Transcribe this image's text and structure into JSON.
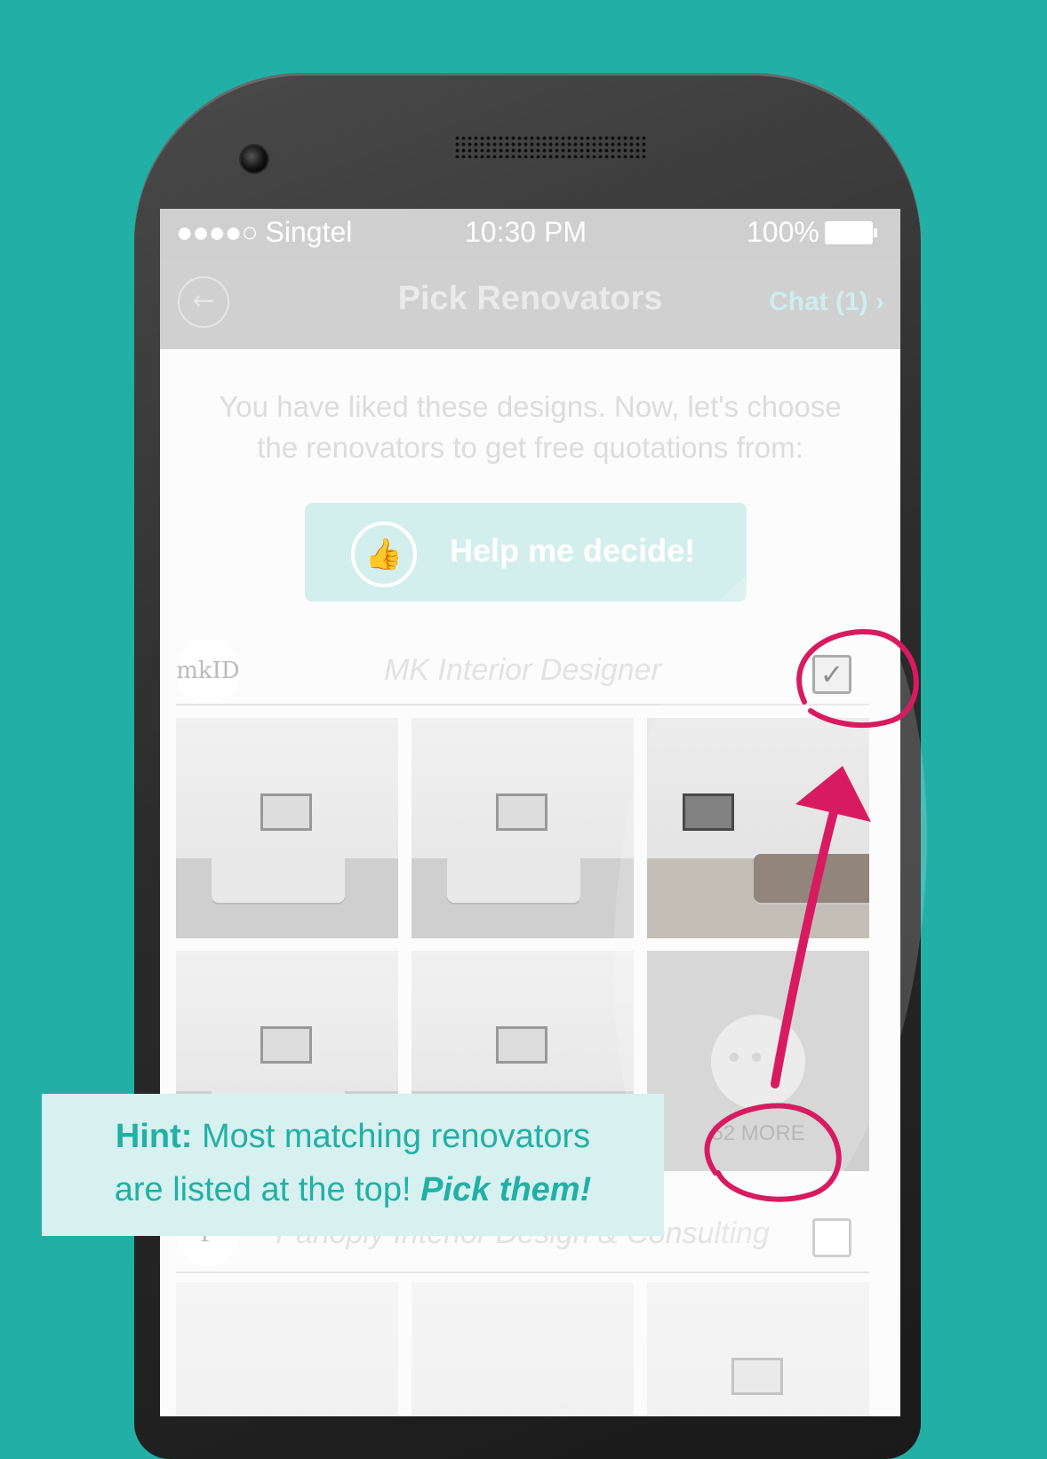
{
  "status_bar": {
    "signal_dots": "●●●●○",
    "carrier": "Singtel",
    "time": "10:30 PM",
    "battery": "100%"
  },
  "nav": {
    "back_icon": "arrow-left-icon",
    "title": "Pick Renovators",
    "chat_link": "Chat (1)",
    "chat_chevron": "›"
  },
  "intro_text_line1": "You have liked these designs. Now, let's choose",
  "intro_text_line2": "the renovators to get free quotations from:",
  "help_button": {
    "icon": "thumbs-up-icon",
    "label": "Help me decide!"
  },
  "vendors": [
    {
      "logo": "mkID",
      "name": "MK Interior Designer",
      "checked": true,
      "more_count_label": "52 MORE"
    },
    {
      "logo": "P",
      "name": "Panoply Interior Design & Consulting",
      "checked": false
    }
  ],
  "hint": {
    "label": "Hint:",
    "text1": "Most matching renovators",
    "text2": "are listed at the top!",
    "emphasis": "Pick them!"
  },
  "colors": {
    "background": "#22b0a6",
    "accent": "#22b0a6",
    "annotation": "#d81b60",
    "hint_bg": "#d6f1ef"
  }
}
